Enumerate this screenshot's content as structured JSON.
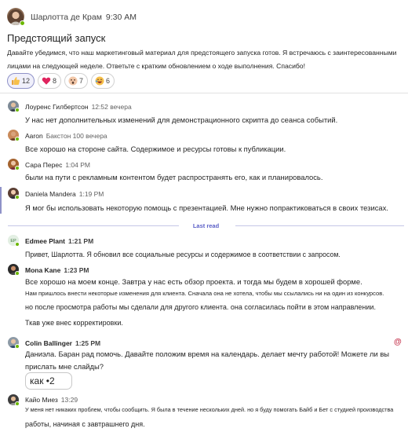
{
  "root": {
    "author": "Шарлотта де Крам",
    "time": "9:30 AM",
    "title": "Предстоящий запуск",
    "body": "Давайте убедимся, что наш маркетинговый материал для предстоящего запуска готов. Я встречаюсь с заинтересованными лицами на следующей неделе. Ответьте с кратким обновлением о ходе выполнения. Спасибо!",
    "reactions": [
      {
        "icon": "thumbs-up-icon",
        "count": "12"
      },
      {
        "icon": "heart-icon",
        "count": "8"
      },
      {
        "icon": "surprised-icon",
        "count": "7"
      },
      {
        "icon": "laugh-icon",
        "count": "6"
      }
    ]
  },
  "replies": [
    {
      "author": "Лоуренс Гилбертсон",
      "time": "12:52 вечера",
      "lines": [
        "У нас нет дополнительных изменений для демонстрационного скрипта до сеанса событий."
      ]
    },
    {
      "author": "Aaron",
      "time": "Бакстон 100 вечера",
      "lines": [
        "Все хорошо на стороне сайта. Содержимое и ресурсы готовы к публикации."
      ]
    },
    {
      "author": "Сара Перес",
      "time": "1:04 PM",
      "lines": [
        "были на пути с рекламным контентом будет распространять его, как и планировалось."
      ]
    },
    {
      "author": "Daniela Mandera",
      "time": "1:19 PM",
      "lines": [
        "Я мог бы использовать некоторую помощь с презентацией. Мне нужно попрактиковаться в своих тезисах."
      ]
    },
    {
      "author": "Edmee Plant",
      "time": "1:21 PM",
      "lines": [
        "Привет, Шарлотта. Я обновил все социальные ресурсы и содержимое в соответствии с запросом."
      ]
    },
    {
      "author": "Mona Kane",
      "time": "1:23 PM",
      "lines": [
        "Все хорошо на моем конце. Завтра у нас есть обзор проекта. и тогда мы будем в хорошей форме.",
        "Нам пришлось внести некоторые изменения для клиента. Сначала она не хотела, чтобы мы ссылались ни на один из конкурсов.",
        "но после просмотра работы мы сделали для другого клиента. она согласилась пойти в этом направлении.",
        "Ткав уже внес корректировки."
      ]
    },
    {
      "author": "Colin Ballinger",
      "time": "1:25 PM",
      "lines": [
        "Даниэла. Баран рад помочь. Давайте положим время на календарь. делает мечту работой! Можете ли вы",
        "прислать мне слайды?"
      ],
      "chip": "как •2"
    },
    {
      "author": "Кайо Миез",
      "time": "13:29",
      "lines": [
        "У меня нет никаких проблем, чтобы сообщить. Я была в течение нескольких дней. но я буду помогать Байб и Бет с студией производства",
        "работы, начиная с завтрашнего дня."
      ]
    }
  ],
  "last_read_label": "Last read",
  "mention_symbol": "@",
  "colors": {
    "accent": "#5b5fc7",
    "presence": "#6bb700",
    "mention": "#c4314b"
  }
}
